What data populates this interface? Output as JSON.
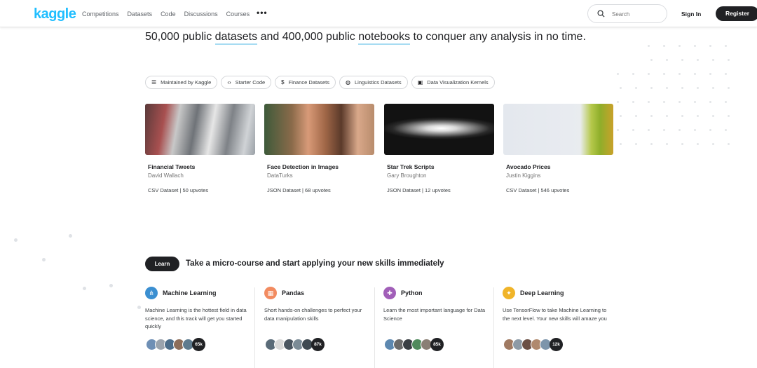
{
  "nav": {
    "logo": "kaggle",
    "links": [
      "Competitions",
      "Datasets",
      "Code",
      "Discussions",
      "Courses"
    ],
    "more": "•••",
    "search_placeholder": "Search",
    "signin": "Sign In",
    "register": "Register"
  },
  "hero": {
    "part1": "50,000 public ",
    "link1": "datasets",
    "part2": " and 400,000 public ",
    "link2": "notebooks",
    "part3": " to conquer any analysis in no time."
  },
  "chips": [
    {
      "icon": "list-icon",
      "glyph": "☰",
      "label": "Maintained by Kaggle"
    },
    {
      "icon": "code-icon",
      "glyph": "‹›",
      "label": "Starter Code"
    },
    {
      "icon": "dollar-icon",
      "glyph": "$",
      "label": "Finance Datasets"
    },
    {
      "icon": "globe-icon",
      "glyph": "◍",
      "label": "Linguistics Datasets"
    },
    {
      "icon": "image-icon",
      "glyph": "▣",
      "label": "Data Visualization Kernels"
    }
  ],
  "datasets": [
    {
      "title": "Financial Tweets",
      "author": "David Wallach",
      "meta": "CSV Dataset | 50 upvotes"
    },
    {
      "title": "Face Detection in Images",
      "author": "DataTurks",
      "meta": "JSON Dataset | 68 upvotes"
    },
    {
      "title": "Star Trek Scripts",
      "author": "Gary Broughton",
      "meta": "JSON Dataset | 12 upvotes"
    },
    {
      "title": "Avocado Prices",
      "author": "Justin Kiggins",
      "meta": "CSV Dataset | 546 upvotes"
    }
  ],
  "learn": {
    "button": "Learn",
    "title": "Take a micro-course and start applying your new skills immediately",
    "courses": [
      {
        "name": "Machine Learning",
        "icon": "network-icon",
        "color": "#3b8fd1",
        "desc": "Machine Learning is the hottest field in data science, and this track will get you started quickly",
        "count": "65k"
      },
      {
        "name": "Pandas",
        "icon": "table-icon",
        "color": "#f28b60",
        "desc": "Short hands-on challenges to perfect your data manipulation skills",
        "count": "87k"
      },
      {
        "name": "Python",
        "icon": "python-icon",
        "color": "#a15fb8",
        "desc": "Learn the most important language for Data Science",
        "count": "85k"
      },
      {
        "name": "Deep Learning",
        "icon": "brain-icon",
        "color": "#f0b429",
        "desc": "Use TensorFlow to take Machine Learning to the next level. Your new skills will amaze you",
        "count": "12k"
      }
    ]
  }
}
